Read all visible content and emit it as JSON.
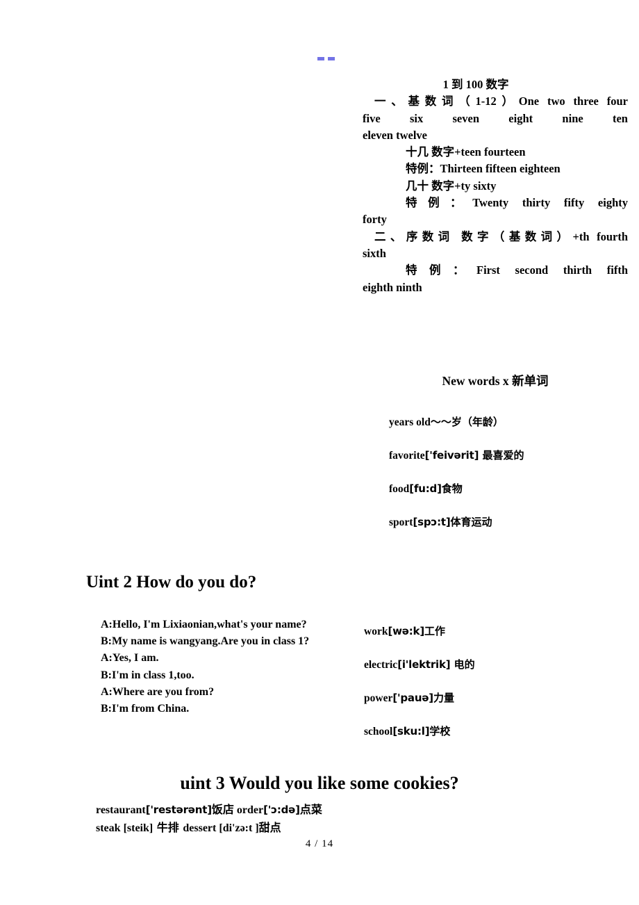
{
  "page": {
    "footer": "4 / 14",
    "marker_color": "#7373e6"
  },
  "numbers_section": {
    "title": "1 到 100 数字",
    "lines": [
      "一、基数词（1-12）One   two   three   four",
      "five    six    seven    eight    nine    ten",
      "eleven   twelve",
      "十几   数字+teen   fourteen",
      "特例：Thirteen   fifteen   eighteen",
      "几十   数字+ty   sixty",
      "特例：Twenty   thirty   fifty   eighty",
      "forty",
      "二、序数词 数字（基数词）+th   fourth",
      "sixth",
      "特例：First   second   thirth   fifth",
      "eighth   ninth"
    ]
  },
  "new_words": {
    "heading": "New words x 新单词",
    "items": [
      {
        "word": "years old",
        "phonetic": "",
        "gloss": "～～岁（年龄）"
      },
      {
        "word": "favorite",
        "phonetic": "['feivərit]",
        "gloss": " 最喜爱的"
      },
      {
        "word": "food",
        "phonetic": "[fu:d]",
        "gloss": "食物"
      },
      {
        "word": "sport",
        "phonetic": "[spɔ:t]",
        "gloss": "体育运动"
      }
    ]
  },
  "unit2": {
    "title": "Uint 2    How do you do?",
    "dialogue": [
      "A:Hello,  I'm  Lixiaonian,what's  your name?",
      "B:My  name  is  wangyang.Are  you  in class 1?",
      "A:Yes, I am.",
      "B:I'm in class 1,too.",
      "A:Where are you from?",
      "B:I'm from China."
    ],
    "vocab": [
      {
        "word": "work",
        "phonetic": "[wə:k]",
        "gloss": "工作"
      },
      {
        "word": "electric",
        "phonetic": "[i'lektrik]",
        "gloss": " 电的"
      },
      {
        "word": "power",
        "phonetic": "['pauə]",
        "gloss": "力量"
      },
      {
        "word": "school",
        "phonetic": "[sku:l]",
        "gloss": "学校"
      }
    ]
  },
  "unit3": {
    "title": "uint 3 Would you like some cookies?",
    "lines": [
      {
        "a_word": "restaurant",
        "a_ipa": "['restərənt]",
        "a_gloss": "饭店",
        "b_word": "  order",
        "b_ipa": "['ɔ:də]",
        "b_gloss": "点菜"
      },
      {
        "a_word": "steak ",
        "a_ipa": "[steik]",
        "a_gloss": "  牛排 ",
        "b_word": "dessert ",
        "b_ipa": "[di'zə:t ]",
        "b_gloss": "甜点"
      }
    ]
  }
}
